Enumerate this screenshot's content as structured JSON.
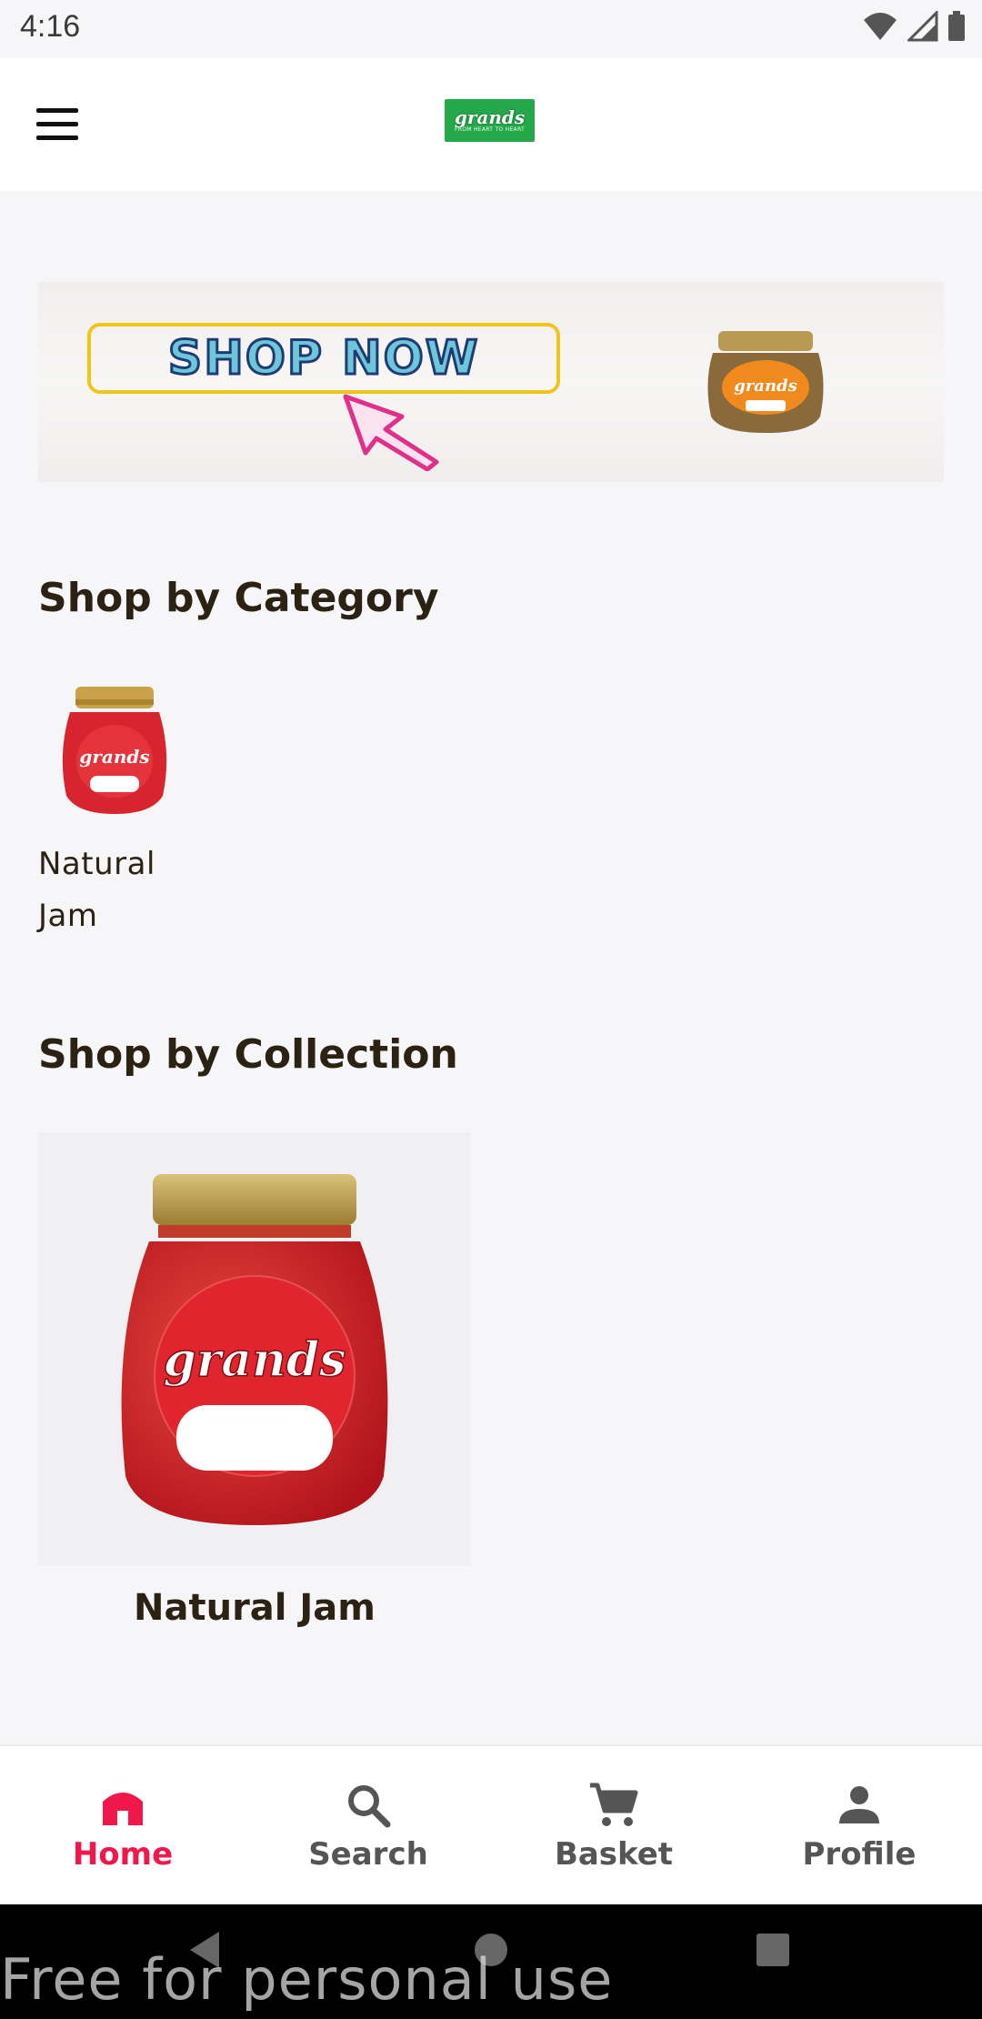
{
  "status_bar": {
    "time": "4:16"
  },
  "header": {
    "logo_text": "grands",
    "logo_tagline": "FROM HEART TO HEART"
  },
  "banner": {
    "cta_text": "SHOP NOW"
  },
  "sections": {
    "category_title": "Shop by Category",
    "categories": [
      {
        "label": "Natural Jam"
      }
    ],
    "collection_title": "Shop by Collection",
    "collections": [
      {
        "label": "Natural Jam"
      }
    ]
  },
  "bottom_nav": {
    "items": [
      {
        "label": "Home",
        "icon": "home-icon",
        "active": true
      },
      {
        "label": "Search",
        "icon": "search-icon",
        "active": false
      },
      {
        "label": "Basket",
        "icon": "cart-icon",
        "active": false
      },
      {
        "label": "Profile",
        "icon": "person-icon",
        "active": false
      }
    ]
  },
  "watermark": "Free for personal use",
  "colors": {
    "accent": "#f0184b",
    "logo_green": "#25a84a",
    "background": "#f6f5f7"
  }
}
